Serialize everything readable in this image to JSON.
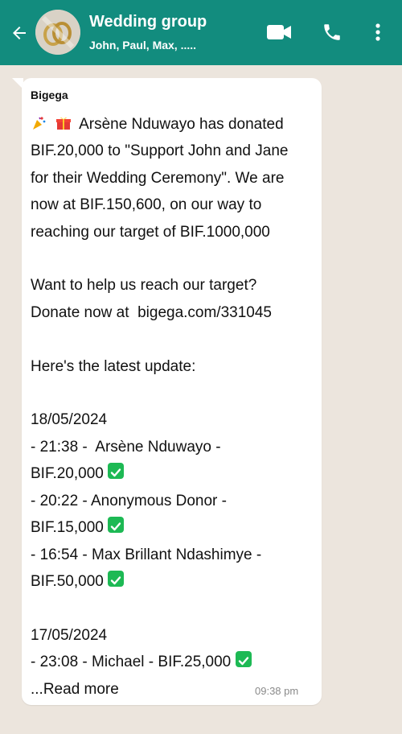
{
  "header": {
    "title": "Wedding group",
    "subtitle": "John, Paul, Max, .....",
    "colors": {
      "bar": "#128c7e",
      "text": "#ffffff"
    },
    "icons": [
      "back-arrow-icon",
      "group-avatar",
      "video-call-icon",
      "phone-icon",
      "more-options-icon"
    ]
  },
  "message": {
    "sender": "Bigega",
    "line1": "Arsène Nduwayo has donated",
    "line2": "BIF.20,000 to \"Support John and Jane",
    "line3": "for their Wedding Ceremony\". We are",
    "line4": "now at BIF.150,600, on our way to",
    "line5": "reaching our target of BIF.1000,000",
    "line6": "Want to help us reach our target?",
    "line7": "Donate now at  bigega.com/331045",
    "line8": "Here's the latest update:",
    "date1": "18/05/2024",
    "d1a": "- 21:38 -  Arsène Nduwayo -",
    "d1a_amount": "BIF.20,000",
    "d1b": "- 20:22 - Anonymous Donor -",
    "d1b_amount": "BIF.15,000",
    "d1c": "- 16:54 - Max Brillant Ndashimye -",
    "d1c_amount": "BIF.50,000",
    "date2": "17/05/2024",
    "d2a": "- 23:08 - Michael - BIF.25,000",
    "read_more": "...Read more",
    "time": "09:38 pm",
    "colors": {
      "bubble": "#ffffff",
      "check": "#1db954",
      "timestamp": "#8a8a8a"
    }
  }
}
